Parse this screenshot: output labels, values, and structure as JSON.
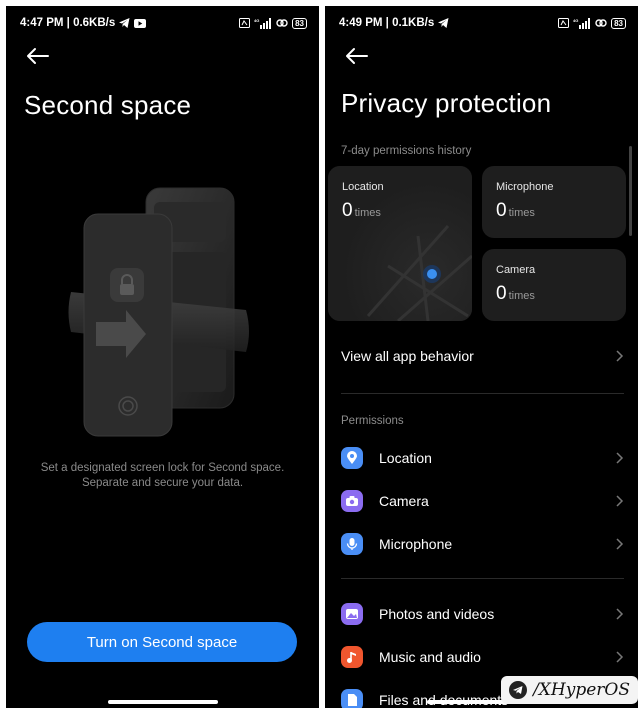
{
  "left": {
    "status": {
      "time_speed": "4:47 PM | 0.6KB/s",
      "battery": "83"
    },
    "title": "Second space",
    "description_line1": "Set a designated screen lock for Second space.",
    "description_line2": "Separate and secure your data.",
    "cta_label": "Turn on Second space"
  },
  "right": {
    "status": {
      "time_speed": "4:49 PM | 0.1KB/s",
      "battery": "83"
    },
    "title": "Privacy protection",
    "history_label": "7-day permissions history",
    "cards": {
      "location": {
        "label": "Location",
        "count": "0",
        "unit": "times"
      },
      "microphone": {
        "label": "Microphone",
        "count": "0",
        "unit": "times"
      },
      "camera": {
        "label": "Camera",
        "count": "0",
        "unit": "times"
      }
    },
    "view_all": "View all app behavior",
    "permissions_label": "Permissions",
    "permissions": [
      {
        "label": "Location",
        "icon": "location-pin-icon",
        "color": "#4a8ef5"
      },
      {
        "label": "Camera",
        "icon": "camera-icon",
        "color": "#8b6cf0"
      },
      {
        "label": "Microphone",
        "icon": "microphone-icon",
        "color": "#4a8ef5"
      }
    ],
    "media": [
      {
        "label": "Photos and videos",
        "icon": "photos-icon",
        "color": "#8b6cf0"
      },
      {
        "label": "Music and audio",
        "icon": "music-icon",
        "color": "#f0562e"
      },
      {
        "label": "Files and documents",
        "icon": "files-icon",
        "color": "#4a8ef5"
      }
    ],
    "watermark": "/XHyperOS"
  }
}
